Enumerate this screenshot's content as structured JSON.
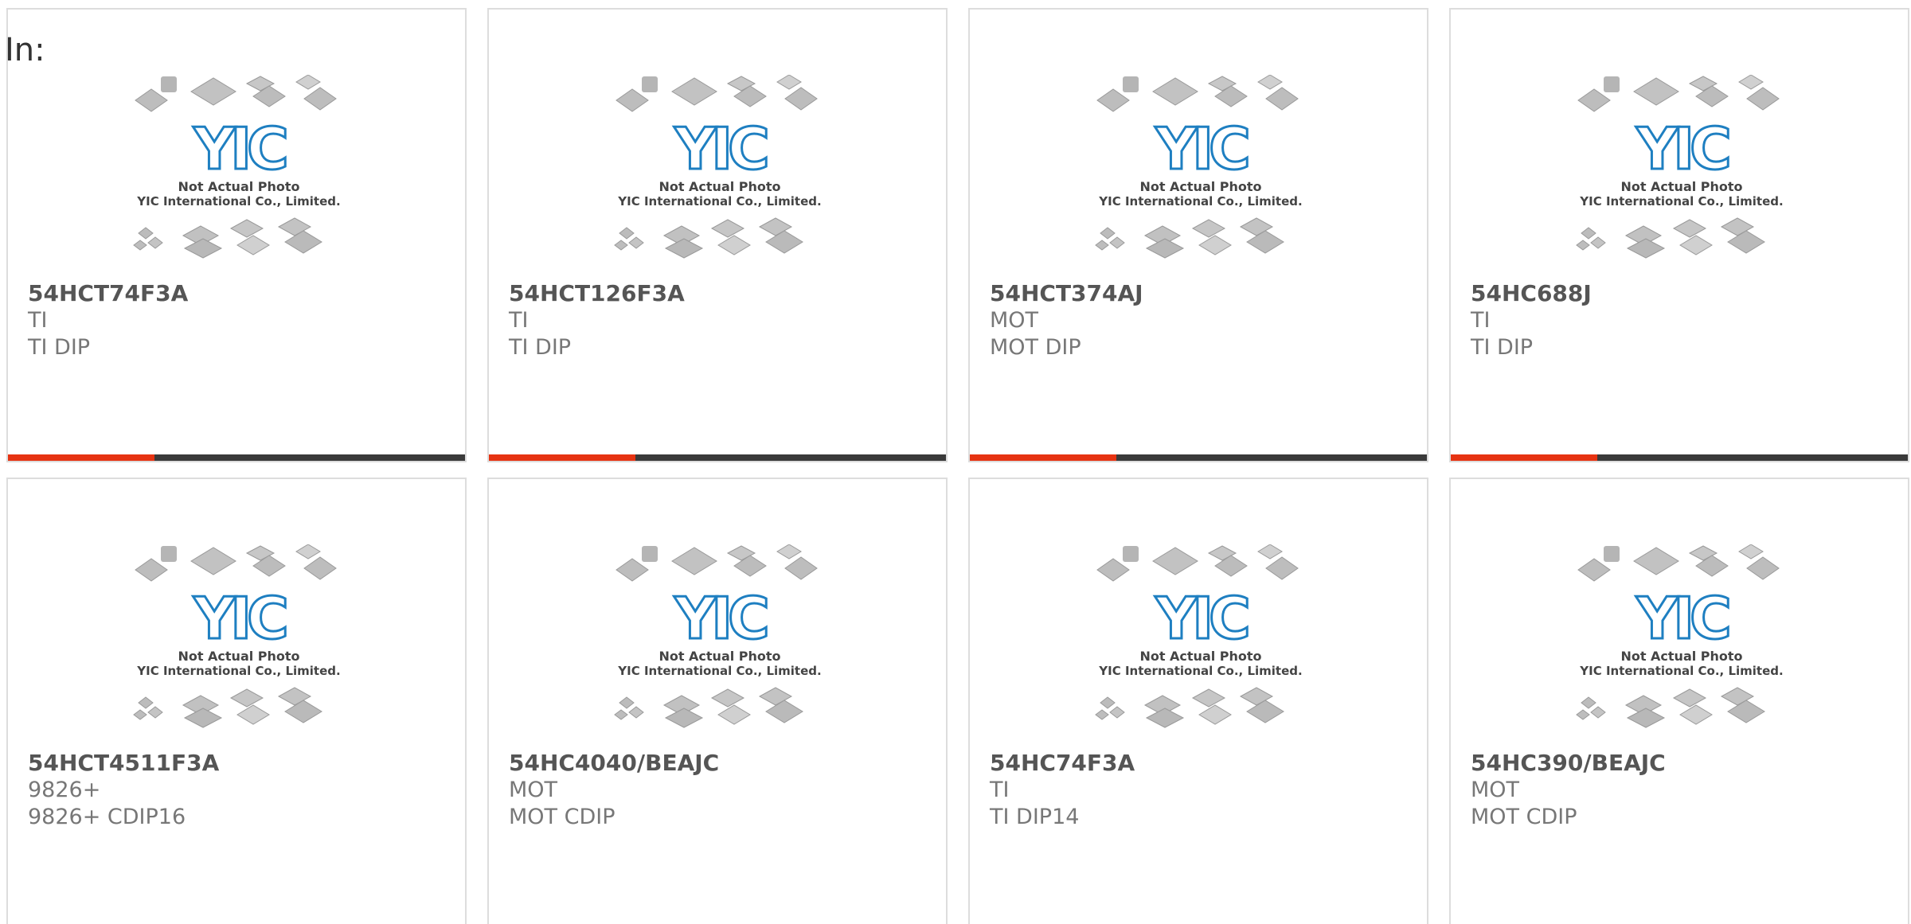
{
  "header": {
    "label": "In:"
  },
  "image": {
    "caption_line1": "Not Actual Photo",
    "caption_line2": "YIC International Co., Limited.",
    "logo_text": "YIC"
  },
  "colors": {
    "accent": "#e63312",
    "bar": "#3a3a3a",
    "logo": "#1e7fc1"
  },
  "products": [
    {
      "part": "54HCT74F3A",
      "manufacturer": "TI",
      "package": "TI DIP"
    },
    {
      "part": "54HCT126F3A",
      "manufacturer": "TI",
      "package": "TI DIP"
    },
    {
      "part": "54HCT374AJ",
      "manufacturer": "MOT",
      "package": "MOT DIP"
    },
    {
      "part": "54HC688J",
      "manufacturer": "TI",
      "package": "TI DIP"
    },
    {
      "part": "54HCT4511F3A",
      "manufacturer": "9826+",
      "package": "9826+ CDIP16"
    },
    {
      "part": "54HC4040/BEAJC",
      "manufacturer": "MOT",
      "package": "MOT CDIP"
    },
    {
      "part": "54HC74F3A",
      "manufacturer": "TI",
      "package": "TI DIP14"
    },
    {
      "part": "54HC390/BEAJC",
      "manufacturer": "MOT",
      "package": "MOT CDIP"
    }
  ]
}
